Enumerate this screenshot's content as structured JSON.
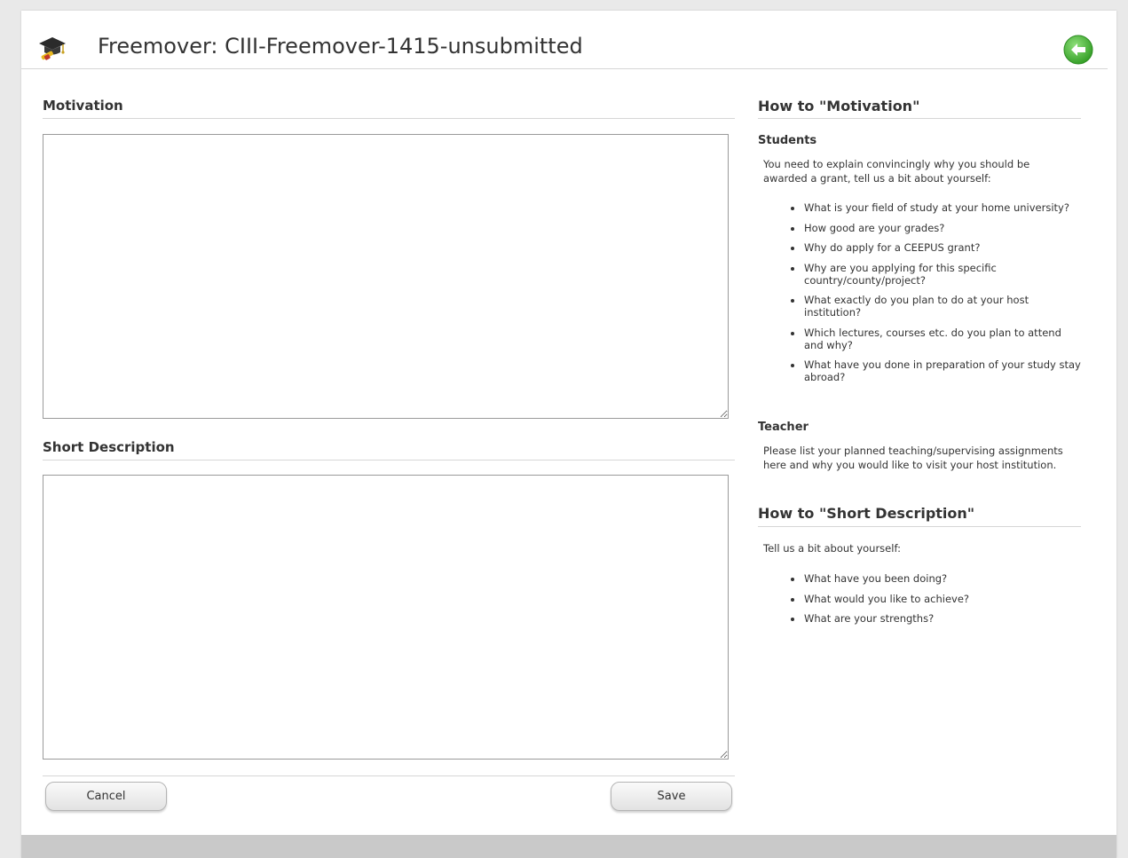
{
  "header": {
    "title": "Freemover: CIII-Freemover-1415-unsubmitted",
    "icon": "graduation-cap-icon",
    "back_icon": "back-arrow-icon",
    "accent_green": "#3aa52a"
  },
  "form": {
    "motivation_label": "Motivation",
    "motivation_value": "",
    "short_description_label": "Short Description",
    "short_description_value": "",
    "cancel_label": "Cancel",
    "save_label": "Save"
  },
  "help": {
    "motivation_title": "How to \"Motivation\"",
    "students_title": "Students",
    "students_intro": "You need to explain convincingly why you should be awarded a grant, tell us a bit about yourself:",
    "students_items": [
      "What is your field of study at your home university?",
      "How good are your grades?",
      "Why do apply for a CEEPUS grant?",
      "Why are you applying for this specific country/county/project?",
      "What exactly do you plan to do at your host institution?",
      "Which lectures, courses etc. do you plan to attend and why?",
      "What have you done in preparation of your study stay abroad?"
    ],
    "teacher_title": "Teacher",
    "teacher_text": "Please list your planned teaching/supervising assignments here and why you would like to visit your host institution.",
    "short_description_title": "How to \"Short Description\"",
    "short_intro": "Tell us a bit about yourself:",
    "short_items": [
      "What have you been doing?",
      "What would you like to achieve?",
      "What are your strengths?"
    ]
  }
}
